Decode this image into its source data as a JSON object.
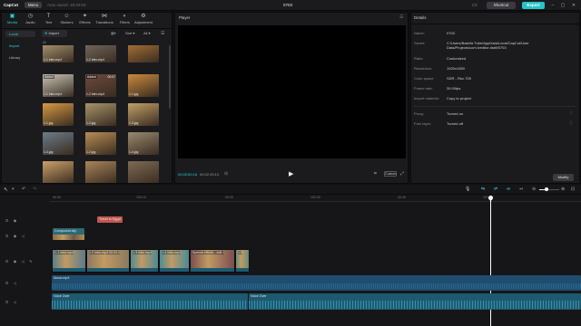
{
  "titlebar": {
    "app_name": "CapCut",
    "menu_label": "Menu",
    "autosave": "Auto saved: 18:40:53",
    "project_title": "0703",
    "shortcut_label": "Shortcut",
    "export_label": "Export"
  },
  "toolbar": {
    "tabs": [
      {
        "label": "Media",
        "icon": "media-icon"
      },
      {
        "label": "Audio",
        "icon": "audio-icon"
      },
      {
        "label": "Text",
        "icon": "text-icon"
      },
      {
        "label": "Stickers",
        "icon": "sticker-icon"
      },
      {
        "label": "Effects",
        "icon": "effects-icon"
      },
      {
        "label": "Transitions",
        "icon": "transitions-icon"
      },
      {
        "label": "Filters",
        "icon": "filters-icon"
      },
      {
        "label": "Adjustment",
        "icon": "adjustment-icon"
      }
    ],
    "active_tab": "Media"
  },
  "media": {
    "sidebar": [
      {
        "label": "Local",
        "active": true
      },
      {
        "label": "Import",
        "active": false
      },
      {
        "label": "Library",
        "active": false
      }
    ],
    "import_label": "Import",
    "sort_label": "Sort",
    "filter_label": "All",
    "all_tag": "All",
    "items": [
      {
        "label": "1-1 intro.mp4",
        "added": "",
        "duration": "",
        "color": "#b8a37a"
      },
      {
        "label": "1-2 intro.mp4",
        "added": "",
        "duration": "",
        "color": "#7a7066"
      },
      {
        "label": "",
        "added": "",
        "duration": "",
        "color": "#b57a3a"
      },
      {
        "label": "1-1 intro.mp4",
        "added": "Added",
        "duration": "",
        "color": "#c9c4b8"
      },
      {
        "label": "1-2 intro.mp4",
        "added": "Added",
        "duration": "00:07",
        "color": "#6d4a3e"
      },
      {
        "label": "1-1.jpg",
        "added": "",
        "duration": "",
        "color": "#c98a3e"
      },
      {
        "label": "1-1.jpg",
        "added": "",
        "duration": "",
        "color": "#d69a44"
      },
      {
        "label": "1-2.jpg",
        "added": "",
        "duration": "",
        "color": "#a8956b"
      },
      {
        "label": "1-3.jpg",
        "added": "",
        "duration": "",
        "color": "#c1a067"
      },
      {
        "label": "1-4.jpg",
        "added": "",
        "duration": "",
        "color": "#6b7d8a"
      },
      {
        "label": "1-2.jpg",
        "added": "",
        "duration": "",
        "color": "#b88d55"
      },
      {
        "label": "1-4.jpg",
        "added": "",
        "duration": "",
        "color": "#9a8a72"
      },
      {
        "label": "",
        "added": "",
        "duration": "",
        "color": "#caa06a"
      },
      {
        "label": "",
        "added": "",
        "duration": "",
        "color": "#a9845a"
      },
      {
        "label": "",
        "added": "",
        "duration": "",
        "color": "#7d6b55"
      }
    ]
  },
  "player": {
    "title": "Player",
    "current_time": "00:00:50:18",
    "total_time": "00:02:25:13",
    "ratio_label": "Custom"
  },
  "details": {
    "title": "Details",
    "rows": [
      {
        "key": "Name:",
        "value": "0703"
      },
      {
        "key": "Saved:",
        "value": "C:/Users/Basefa Tube/AppData/Local/CapCut/User Data/Projects/com.lveditor.draft/0703"
      },
      {
        "key": "Ratio:",
        "value": "Customized"
      },
      {
        "key": "Resolution:",
        "value": "1920x1080"
      },
      {
        "key": "Color space:",
        "value": "SDR - Rec.709"
      },
      {
        "key": "Frame rate:",
        "value": "30.00fps"
      },
      {
        "key": "Import material:",
        "value": "Copy to project"
      },
      {
        "key": "Proxy:",
        "value": "Turned on"
      },
      {
        "key": "Free layer:",
        "value": "Turned off"
      }
    ],
    "modify_label": "Modify"
  },
  "timeline": {
    "ruler": [
      "00:00",
      "100:10",
      "00:20",
      "100:30",
      "00:40",
      "100:50"
    ],
    "text_clip": "Travel to Egypt",
    "compound_clip": "Compound clip",
    "video_clips": [
      {
        "label": "1-1 intro.mp4",
        "color": "#5a7c88"
      },
      {
        "label": "1-2 intro.mp4  00:00:2",
        "color": "#8a7a5e"
      },
      {
        "label": "1-3 intro.mp4",
        "color": "#4d8a94"
      },
      {
        "label": "1-4 intro.mp4",
        "color": "#4b8c97"
      },
      {
        "label": "Special effects - edit 1",
        "color": "#7a4e4e"
      },
      {
        "label": "1-5",
        "color": "#6a8c7a"
      }
    ],
    "music_clip": "Music.mp3",
    "voice_clips": [
      "Voice Over",
      "Voice Over"
    ]
  },
  "colors": {
    "accent": "#2ad1d4",
    "audio_track": "#1f4d6e",
    "voice_track": "#1d5a70"
  }
}
